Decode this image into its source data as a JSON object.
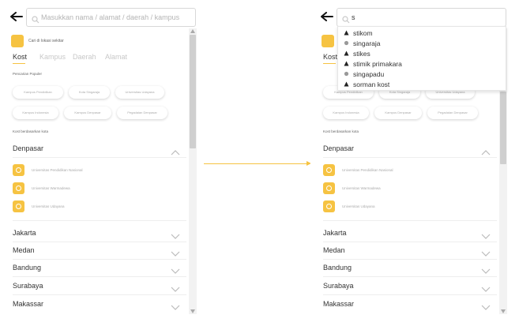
{
  "left_screen": {
    "search": {
      "placeholder": "Masukkan nama / alamat / daerah / kampus",
      "value": ""
    },
    "cari_text": "Cari di lokasi sekitar",
    "tabs": [
      "Kost",
      "Kampus",
      "Daerah",
      "Alamat"
    ],
    "popular_label": "Pencarian Populer",
    "chips_row1": [
      "Kampus Pendidikan",
      "Kota Singaraja",
      "Universitas Udayana"
    ],
    "chips_row2": [
      "Kampus Indonesia",
      "Kampus Denpasar",
      "Pegadaian Denpasar"
    ],
    "cities_label": "Kost berdasarkan kota",
    "expanded_city": "Denpasar",
    "universities": [
      "Universitas Pendidikan Nasional",
      "Universitas Warmadewa",
      "Universitas Udayana"
    ],
    "cities": [
      "Jakarta",
      "Medan",
      "Bandung",
      "Surabaya",
      "Makassar"
    ]
  },
  "right_screen": {
    "search": {
      "value": "s"
    },
    "suggestions": [
      {
        "text": "stikom",
        "icon": "building-icon"
      },
      {
        "text": "singaraja",
        "icon": "location-icon"
      },
      {
        "text": "stikes",
        "icon": "building-icon"
      },
      {
        "text": "stimik primakara",
        "icon": "building-icon"
      },
      {
        "text": "singapadu",
        "icon": "location-icon"
      },
      {
        "text": "sorman kost",
        "icon": "home-icon"
      }
    ]
  },
  "colors": {
    "accent": "#f6c342",
    "text": "#333333",
    "muted": "#aaaaaa"
  }
}
